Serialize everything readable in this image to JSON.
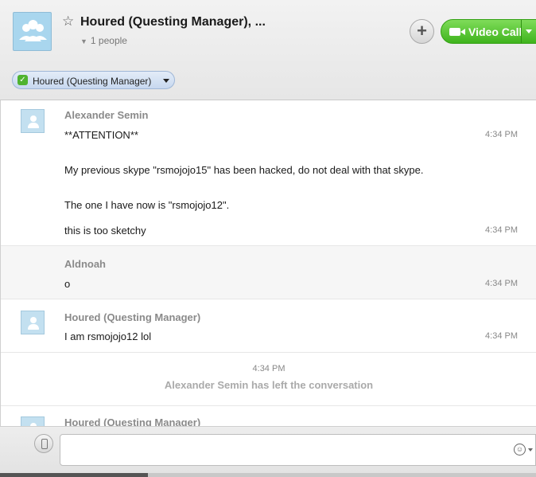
{
  "header": {
    "title": "Houred (Questing Manager), ...",
    "participants": "1 people",
    "video_call_label": "Video Call",
    "add_icon": "plus-icon",
    "video_icon": "video-camera-icon",
    "favorite_icon": "star-icon"
  },
  "participant_pill": {
    "label": "Houred (Questing Manager)",
    "status": "online"
  },
  "messages": [
    {
      "sender": "Alexander Semin",
      "lines": [
        "**ATTENTION**",
        "My previous skype \"rsmojojo15\" has been hacked, do not deal with that skype.",
        "The one I have now is \"rsmojojo12\"."
      ],
      "time": "4:34 PM"
    },
    {
      "text": "this is too sketchy",
      "time": "4:34 PM"
    },
    {
      "sender": "Aldnoah",
      "text": "o",
      "time": "4:34 PM"
    },
    {
      "sender": "Houred (Questing Manager)",
      "text": "I am rsmojojo12 lol",
      "time": "4:34 PM"
    }
  ],
  "system": {
    "time": "4:34 PM",
    "text": "Alexander Semin has left the conversation"
  },
  "next_sender": "Houred (Questing Manager)",
  "colors": {
    "accent_green": "#3fb41d",
    "pill_blue": "#c7d8ef"
  }
}
